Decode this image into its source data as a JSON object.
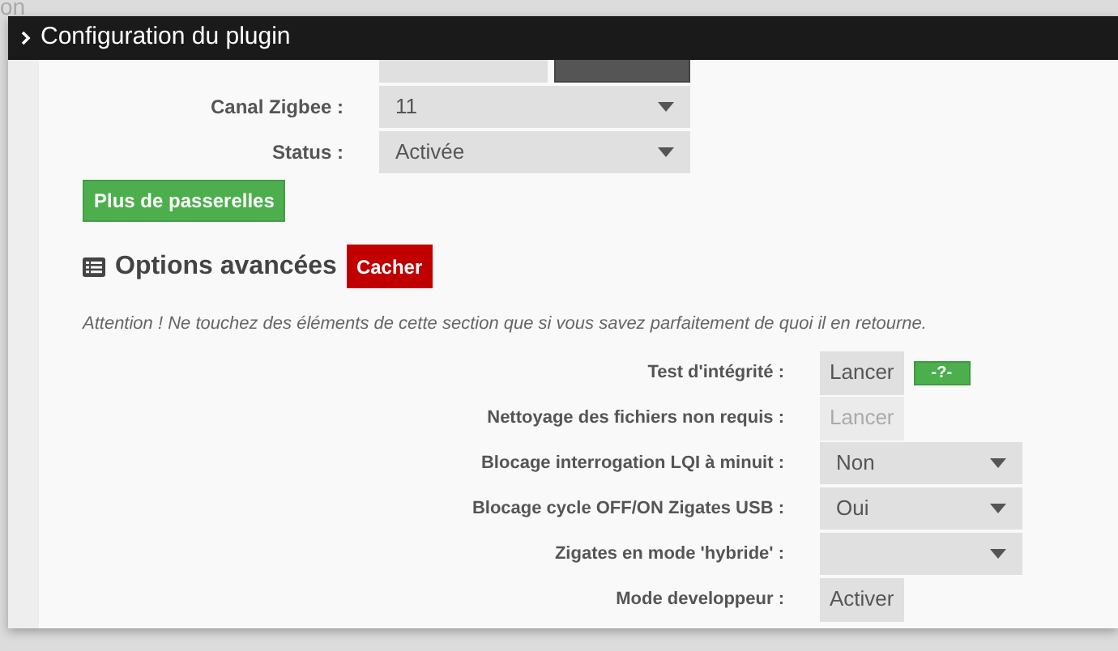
{
  "background_text": "on",
  "panel": {
    "title": "Configuration du plugin",
    "gateway_rows": [
      {
        "kind": "field"
      },
      {
        "kind": "select",
        "label": "Canal Zigbee :",
        "value": "11"
      },
      {
        "kind": "select",
        "label": "Status :",
        "value": "Activée"
      }
    ],
    "more_button": "Plus de passerelles",
    "advanced": {
      "title": "Options avancées",
      "toggle_button": "Cacher",
      "warning": "Attention ! Ne touchez des éléments de cette section que si vous savez parfaitement de quoi il en retourne.",
      "rows": [
        {
          "kind": "button",
          "label": "Test d'intégrité :",
          "button": "Lancer",
          "disabled": false,
          "badge": "-?-"
        },
        {
          "kind": "button",
          "label": "Nettoyage des fichiers non requis :",
          "button": "Lancer",
          "disabled": true
        },
        {
          "kind": "select",
          "label": "Blocage interrogation LQI à minuit :",
          "value": "Non"
        },
        {
          "kind": "select",
          "label": "Blocage cycle OFF/ON Zigates USB :",
          "value": "Oui"
        },
        {
          "kind": "select",
          "label": "Zigates en mode 'hybride' :"
        },
        {
          "kind": "button",
          "label": "Mode developpeur :",
          "button": "Activer",
          "disabled": false
        }
      ]
    }
  }
}
